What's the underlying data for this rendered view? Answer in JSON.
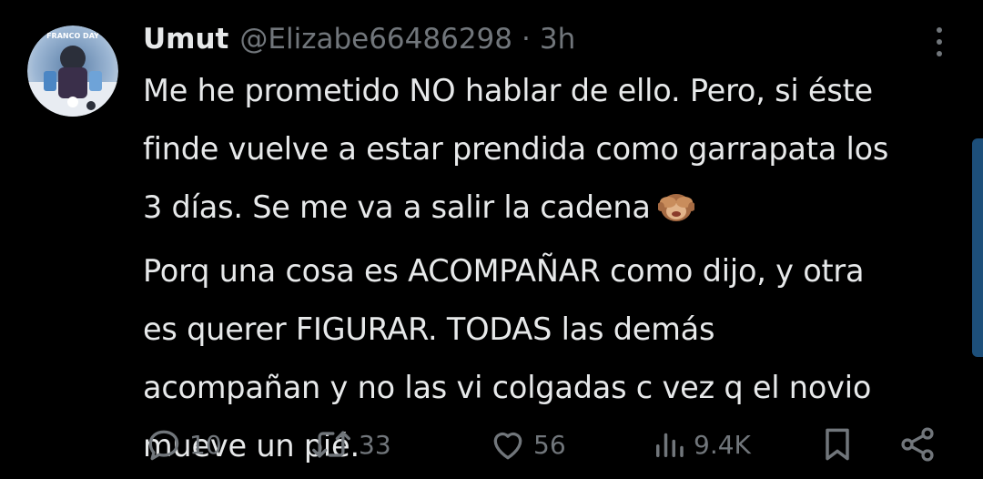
{
  "tweet": {
    "author": {
      "name": "Umut",
      "handle": "@Elizabe66486298",
      "separator": "·",
      "time": "3h",
      "avatar_icon": "avatar-photo",
      "avatar_text": "FRANCO DAY"
    },
    "text_lines": [
      "Me he prometido NO hablar de ello. Pero, si éste",
      "finde vuelve a estar prendida como garrapata los",
      "3 días. Se me va a salir la cadena",
      "Porq una cosa es ACOMPAÑAR como dijo, y otra",
      "es querer FIGURAR. TODAS las demás",
      "acompañan y no las vi colgadas c vez q el novio",
      "mueve un pié."
    ],
    "emoji": "see-no-evil-monkey",
    "actions": {
      "reply_count": "10",
      "retweet_count": "33",
      "like_count": "56",
      "views_count": "9.4K"
    }
  },
  "colors": {
    "background": "#000000",
    "text_primary": "#e7e9ea",
    "text_secondary": "#71767b",
    "scrollbar": "#1d4f7a"
  }
}
